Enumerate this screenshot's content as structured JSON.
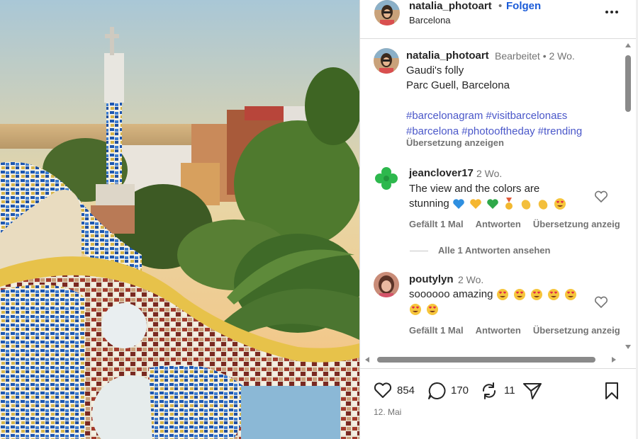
{
  "header": {
    "username": "natalia_photoart",
    "separator": "•",
    "follow_label": "Folgen",
    "location": "Barcelona",
    "more_icon": "more-horizontal-icon"
  },
  "caption": {
    "username": "natalia_photoart",
    "edited_meta": "Bearbeitet •  2 Wo.",
    "line1": "Gaudi's folly",
    "line2": "Parc Guell, Barcelona",
    "hashtags": [
      "#barcelonagram",
      "#visitbarcelonaᴇs",
      "#barcelona",
      "#photooftheday",
      "#trending"
    ],
    "translate_label": "Übersetzung anzeigen"
  },
  "comments": [
    {
      "username": "jeanclover17",
      "time": "2 Wo.",
      "text": "The view and the colors are stunning",
      "emojis": [
        "blue-heart",
        "yellow-heart",
        "green-heart",
        "medal",
        "clapping-hands",
        "clapping-hands",
        "heart-eyes"
      ],
      "likes_label": "Gefällt 1 Mal",
      "reply_label": "Antworten",
      "translate_label": "Übersetzung anzeig"
    },
    {
      "username": "poutylyn",
      "time": "2 Wo.",
      "text": "soooooo amazing",
      "emojis": [
        "heart-eyes",
        "heart-eyes",
        "heart-eyes",
        "heart-eyes",
        "heart-eyes",
        "heart-eyes",
        "heart-eyes"
      ],
      "likes_label": "Gefällt 1 Mal",
      "reply_label": "Antworten",
      "translate_label": "Übersetzung anzeig"
    }
  ],
  "show_replies_label": "Alle 1 Antworten ansehen",
  "actions": {
    "likes": "854",
    "comments": "170",
    "reposts": "11",
    "date": "12. Mai"
  },
  "colors": {
    "link_blue": "#1a5bd8",
    "hashtag": "#4a57c9",
    "muted": "#737373",
    "clover_green": "#2db84d"
  }
}
